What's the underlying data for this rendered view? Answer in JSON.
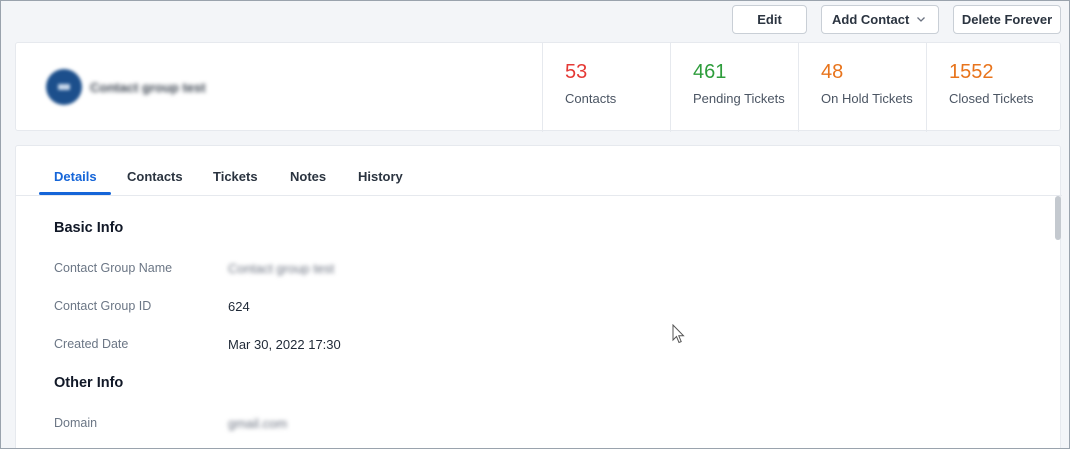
{
  "toolbar": {
    "edit_label": "Edit",
    "add_contact_label": "Add Contact",
    "delete_label": "Delete Forever"
  },
  "summary": {
    "group_name": "Contact group test",
    "stats": [
      {
        "value": "53",
        "label": "Contacts",
        "color": "#e53935"
      },
      {
        "value": "461",
        "label": "Pending Tickets",
        "color": "#2e9d3c"
      },
      {
        "value": "48",
        "label": "On Hold Tickets",
        "color": "#e8741c"
      },
      {
        "value": "1552",
        "label": "Closed Tickets",
        "color": "#e8741c"
      }
    ]
  },
  "tabs": [
    "Details",
    "Contacts",
    "Tickets",
    "Notes",
    "History"
  ],
  "active_tab": "Details",
  "details": {
    "basic_info_title": "Basic Info",
    "rows": [
      {
        "label": "Contact Group Name",
        "value": "Contact group test"
      },
      {
        "label": "Contact Group ID",
        "value": "624"
      },
      {
        "label": "Created Date",
        "value": "Mar 30, 2022 17:30"
      }
    ],
    "other_info_title": "Other Info",
    "other_rows": [
      {
        "label": "Domain",
        "value": "gmail.com"
      }
    ]
  },
  "colors": {
    "accent": "#1565d8",
    "avatar": "#1c4f8c"
  }
}
